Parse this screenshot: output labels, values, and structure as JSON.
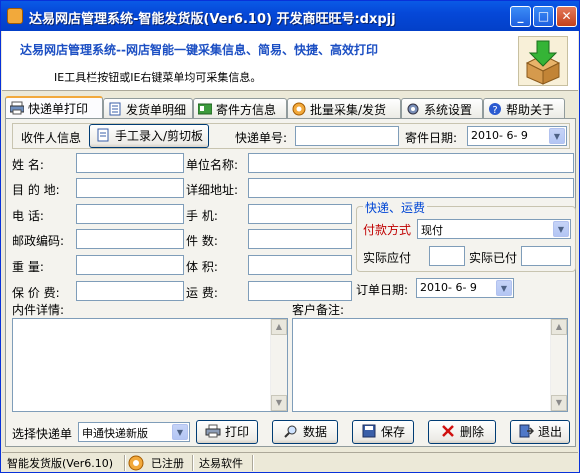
{
  "window": {
    "title": "达易网店管理系统-智能发货版(Ver6.10) 开发商旺旺号:dxpjj",
    "min": "_",
    "max": "□",
    "close": "✕"
  },
  "header": {
    "title": "达易网店管理系统--网店智能一键采集信息、简易、快捷、高效打印",
    "subtitle": "IE工具栏按钮或IE右键菜单均可采集信息。"
  },
  "tabs": [
    "快递单打印",
    "发货单明细",
    "寄件方信息",
    "批量采集/发货",
    "系统设置",
    "帮助关于"
  ],
  "form": {
    "recipient_info_label": "收件人信息",
    "manual_entry_button": "手工录入/剪切板",
    "tracking_no_label": "快递单号:",
    "tracking_no_value": "",
    "ship_date_label": "寄件日期:",
    "ship_date_value": "2010- 6- 9",
    "name_label": "姓    名:",
    "company_label": "单位名称:",
    "destination_label": "目 的 地:",
    "address_label": "详细地址:",
    "phone_label": "电    话:",
    "mobile_label": "手    机:",
    "postcode_label": "邮政编码:",
    "pieces_label": "件    数:",
    "weight_label": "重    量:",
    "volume_label": "体    积:",
    "insured_label": "保 价 费:",
    "freight_label": "运    费:",
    "order_date_label": "订单日期:",
    "order_date_value": "2010- 6- 9",
    "contents_label": "内件详情:",
    "remarks_label": "客户备注:"
  },
  "shipping": {
    "group_title": "快递、运费",
    "payment_label": "付款方式",
    "payment_value": "现付",
    "actual_due_label": "实际应付",
    "actual_paid_label": "实际已付"
  },
  "bottom": {
    "select_courier_label": "选择快递单",
    "courier_value": "申通快递新版",
    "print": "打印",
    "data": "数据",
    "save": "保存",
    "delete": "删除",
    "exit": "退出"
  },
  "status": {
    "version": "智能发货版(Ver6.10)",
    "registered": "已注册",
    "company": "达易软件"
  },
  "colors": {
    "titlebar": "#0548d8",
    "header_title": "#1c4fc3",
    "group_title": "#0046d5",
    "payment_label": "#c00000"
  }
}
